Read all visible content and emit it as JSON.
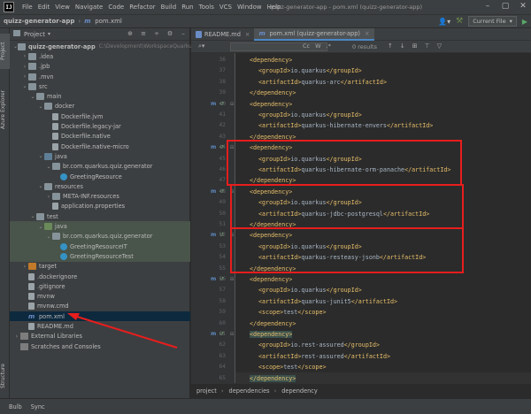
{
  "menubar": {
    "logo": "IJ",
    "items": [
      "File",
      "Edit",
      "View",
      "Navigate",
      "Code",
      "Refactor",
      "Build",
      "Run",
      "Tools",
      "VCS",
      "Window",
      "Help"
    ],
    "window_title": "quizz-generator-app - pom.xml (quizz-generator-app)"
  },
  "navbar": {
    "project": "quizz-generator-app",
    "file": "pom.xml",
    "run_config": "Current File"
  },
  "left_tool": {
    "tabs": [
      "Project",
      "Azure Explorer",
      "Structure"
    ]
  },
  "project_panel": {
    "title": "Project",
    "tree": [
      {
        "label": "quizz-generator-app",
        "sub": "C:\\Development\\WorkspaceQuarkus\\q",
        "icon": "folder",
        "depth": 0,
        "open": true,
        "bold": true
      },
      {
        "label": ".idea",
        "icon": "folder",
        "depth": 1,
        "open": false
      },
      {
        "label": ".jpb",
        "icon": "folder",
        "depth": 1,
        "open": false
      },
      {
        "label": ".mvn",
        "icon": "folder",
        "depth": 1,
        "open": false
      },
      {
        "label": "src",
        "icon": "folder",
        "depth": 1,
        "open": true
      },
      {
        "label": "main",
        "icon": "folder",
        "depth": 2,
        "open": true
      },
      {
        "label": "docker",
        "icon": "folder",
        "depth": 3,
        "open": true
      },
      {
        "label": "Dockerfile.jvm",
        "icon": "file",
        "depth": 4
      },
      {
        "label": "Dockerfile.legacy-jar",
        "icon": "file",
        "depth": 4
      },
      {
        "label": "Dockerfile.native",
        "icon": "file",
        "depth": 4
      },
      {
        "label": "Dockerfile.native-micro",
        "icon": "file",
        "depth": 4
      },
      {
        "label": "java",
        "icon": "folder-b",
        "depth": 3,
        "open": true
      },
      {
        "label": "br.com.quarkus.quiz.generator",
        "icon": "folder",
        "depth": 4,
        "open": true
      },
      {
        "label": "GreetingResource",
        "icon": "class",
        "depth": 5
      },
      {
        "label": "resources",
        "icon": "folder",
        "depth": 3,
        "open": true
      },
      {
        "label": "META-INF.resources",
        "icon": "folder",
        "depth": 4,
        "open": false
      },
      {
        "label": "application.properties",
        "icon": "file",
        "depth": 4
      },
      {
        "label": "test",
        "icon": "folder",
        "depth": 2,
        "open": true
      },
      {
        "label": "java",
        "icon": "folder-g",
        "depth": 3,
        "open": true,
        "green": true
      },
      {
        "label": "br.com.quarkus.quiz.generator",
        "icon": "folder",
        "depth": 4,
        "open": true,
        "green": true
      },
      {
        "label": "GreetingResourceIT",
        "icon": "class",
        "depth": 5,
        "green": true
      },
      {
        "label": "GreetingResourceTest",
        "icon": "class",
        "depth": 5,
        "green": true
      },
      {
        "label": "target",
        "icon": "folder-o",
        "depth": 1,
        "open": false
      },
      {
        "label": ".dockerignore",
        "icon": "file",
        "depth": 1
      },
      {
        "label": ".gitignore",
        "icon": "file",
        "depth": 1
      },
      {
        "label": "mvnw",
        "icon": "file",
        "depth": 1
      },
      {
        "label": "mvnw.cmd",
        "icon": "file",
        "depth": 1
      },
      {
        "label": "pom.xml",
        "icon": "maven",
        "depth": 1,
        "selected": true
      },
      {
        "label": "README.md",
        "icon": "file",
        "depth": 1
      },
      {
        "label": "External Libraries",
        "icon": "lib",
        "depth": 0,
        "open": false
      },
      {
        "label": "Scratches and Consoles",
        "icon": "lib",
        "depth": 0
      }
    ]
  },
  "editor": {
    "tabs": [
      {
        "label": "README.md",
        "active": false
      },
      {
        "label": "pom.xml (quizz-generator-app)",
        "active": true
      }
    ],
    "find": {
      "options": [
        "Cc",
        "W",
        ".*"
      ],
      "results": "0 results"
    },
    "lines": [
      {
        "n": "36",
        "ind": 1,
        "parts": [
          [
            "tag",
            "<dependency>"
          ]
        ]
      },
      {
        "n": "37",
        "ind": 2,
        "parts": [
          [
            "tag",
            "<groupId>"
          ],
          [
            "txt",
            "io.quarkus"
          ],
          [
            "tag",
            "</groupId>"
          ]
        ]
      },
      {
        "n": "38",
        "ind": 2,
        "parts": [
          [
            "tag",
            "<artifactId>"
          ],
          [
            "txt",
            "quarkus-arc"
          ],
          [
            "tag",
            "</artifactId>"
          ]
        ]
      },
      {
        "n": "39",
        "ind": 1,
        "parts": [
          [
            "tag",
            "</dependency>"
          ]
        ]
      },
      {
        "n": "40",
        "ind": 1,
        "parts": [
          [
            "tag",
            "<dependency>"
          ]
        ],
        "mark": true
      },
      {
        "n": "41",
        "ind": 2,
        "parts": [
          [
            "tag",
            "<groupId>"
          ],
          [
            "txt",
            "io.quarkus"
          ],
          [
            "tag",
            "</groupId>"
          ]
        ]
      },
      {
        "n": "42",
        "ind": 2,
        "parts": [
          [
            "tag",
            "<artifactId>"
          ],
          [
            "txt",
            "quarkus-hibernate-envers"
          ],
          [
            "tag",
            "</artifactId>"
          ]
        ]
      },
      {
        "n": "43",
        "ind": 1,
        "parts": [
          [
            "tag",
            "</dependency>"
          ]
        ]
      },
      {
        "n": "44",
        "ind": 1,
        "parts": [
          [
            "tag",
            "<dependency>"
          ]
        ],
        "mark": true
      },
      {
        "n": "45",
        "ind": 2,
        "parts": [
          [
            "tag",
            "<groupId>"
          ],
          [
            "txt",
            "io.quarkus"
          ],
          [
            "tag",
            "</groupId>"
          ]
        ]
      },
      {
        "n": "46",
        "ind": 2,
        "parts": [
          [
            "tag",
            "<artifactId>"
          ],
          [
            "txt",
            "quarkus-hibernate-orm-panache"
          ],
          [
            "tag",
            "</artifactId>"
          ]
        ]
      },
      {
        "n": "47",
        "ind": 1,
        "parts": [
          [
            "tag",
            "</dependency>"
          ]
        ]
      },
      {
        "n": "48",
        "ind": 1,
        "parts": [
          [
            "tag",
            "<dependency>"
          ]
        ],
        "mark": true
      },
      {
        "n": "49",
        "ind": 2,
        "parts": [
          [
            "tag",
            "<groupId>"
          ],
          [
            "txt",
            "io.quarkus"
          ],
          [
            "tag",
            "</groupId>"
          ]
        ]
      },
      {
        "n": "50",
        "ind": 2,
        "parts": [
          [
            "tag",
            "<artifactId>"
          ],
          [
            "txt",
            "quarkus-jdbc-postgresql"
          ],
          [
            "tag",
            "</artifactId>"
          ]
        ]
      },
      {
        "n": "51",
        "ind": 1,
        "parts": [
          [
            "tag",
            "</dependency>"
          ]
        ]
      },
      {
        "n": "52",
        "ind": 1,
        "parts": [
          [
            "tag",
            "<dependency>"
          ]
        ],
        "mark": true
      },
      {
        "n": "53",
        "ind": 2,
        "parts": [
          [
            "tag",
            "<groupId>"
          ],
          [
            "txt",
            "io.quarkus"
          ],
          [
            "tag",
            "</groupId>"
          ]
        ]
      },
      {
        "n": "54",
        "ind": 2,
        "parts": [
          [
            "tag",
            "<artifactId>"
          ],
          [
            "txt",
            "quarkus-resteasy-jsonb"
          ],
          [
            "tag",
            "</artifactId>"
          ]
        ]
      },
      {
        "n": "55",
        "ind": 1,
        "parts": [
          [
            "tag",
            "</dependency>"
          ]
        ]
      },
      {
        "n": "56",
        "ind": 1,
        "parts": [
          [
            "tag",
            "<dependency>"
          ]
        ],
        "mark": true
      },
      {
        "n": "57",
        "ind": 2,
        "parts": [
          [
            "tag",
            "<groupId>"
          ],
          [
            "txt",
            "io.quarkus"
          ],
          [
            "tag",
            "</groupId>"
          ]
        ]
      },
      {
        "n": "58",
        "ind": 2,
        "parts": [
          [
            "tag",
            "<artifactId>"
          ],
          [
            "txt",
            "quarkus-junit5"
          ],
          [
            "tag",
            "</artifactId>"
          ]
        ]
      },
      {
        "n": "59",
        "ind": 2,
        "parts": [
          [
            "tag",
            "<scope>"
          ],
          [
            "txt",
            "test"
          ],
          [
            "tag",
            "</scope>"
          ]
        ]
      },
      {
        "n": "60",
        "ind": 1,
        "parts": [
          [
            "tag",
            "</dependency>"
          ]
        ]
      },
      {
        "n": "61",
        "ind": 1,
        "parts": [
          [
            "tag",
            "<dependency>"
          ]
        ],
        "mark": true,
        "hl": true
      },
      {
        "n": "62",
        "ind": 2,
        "parts": [
          [
            "tag",
            "<groupId>"
          ],
          [
            "txt",
            "io.rest-assured"
          ],
          [
            "tag",
            "</groupId>"
          ]
        ]
      },
      {
        "n": "63",
        "ind": 2,
        "parts": [
          [
            "tag",
            "<artifactId>"
          ],
          [
            "txt",
            "rest-assured"
          ],
          [
            "tag",
            "</artifactId>"
          ]
        ]
      },
      {
        "n": "64",
        "ind": 2,
        "parts": [
          [
            "tag",
            "<scope>"
          ],
          [
            "txt",
            "test"
          ],
          [
            "tag",
            "</scope>"
          ]
        ]
      },
      {
        "n": "65",
        "ind": 1,
        "parts": [
          [
            "tag",
            "</dependency>"
          ]
        ],
        "hl": true,
        "current": true
      },
      {
        "n": "66",
        "ind": 0,
        "parts": [
          [
            "tag",
            "</dependencies>"
          ]
        ]
      }
    ],
    "breadcrumb": [
      "project",
      "dependencies",
      "dependency"
    ]
  },
  "statusbar": {
    "tabs": [
      "Bulb",
      "Sync"
    ]
  },
  "colors": {
    "highlight_box": "#e81d1d",
    "selection": "#0d293e"
  }
}
